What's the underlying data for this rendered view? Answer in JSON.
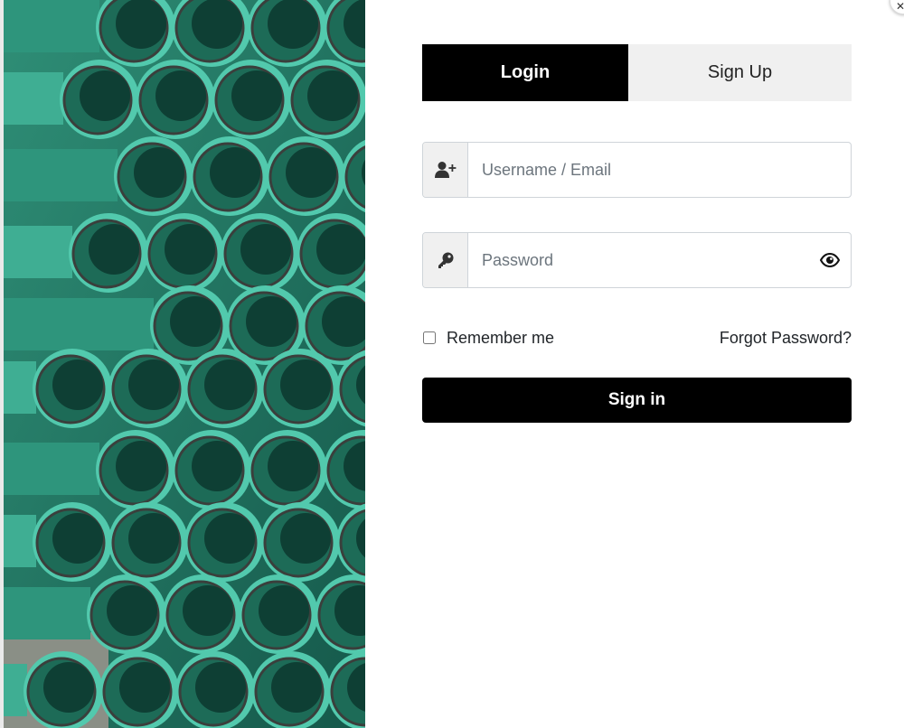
{
  "tabs": {
    "login_label": "Login",
    "signup_label": "Sign Up"
  },
  "fields": {
    "username_placeholder": "Username / Email",
    "password_placeholder": "Password"
  },
  "options": {
    "remember_label": "Remember me",
    "forgot_label": "Forgot Password?"
  },
  "actions": {
    "signin_label": "Sign in"
  },
  "icons": {
    "username": "user-plus-icon",
    "password": "key-icon",
    "toggle_password": "eye-icon",
    "close": "close-icon"
  },
  "colors": {
    "primary": "#000000",
    "tab_inactive_bg": "#f0f0f0",
    "addon_bg": "#f0f0f0",
    "pipe_teal": "#52c9ad"
  }
}
